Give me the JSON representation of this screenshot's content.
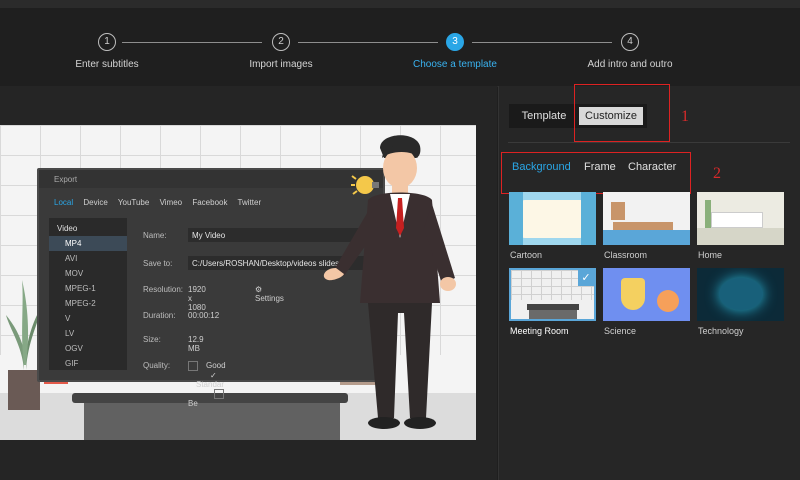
{
  "steps": [
    {
      "num": "1",
      "label": "Enter subtitles"
    },
    {
      "num": "2",
      "label": "Import images"
    },
    {
      "num": "3",
      "label": "Choose a template"
    },
    {
      "num": "4",
      "label": "Add intro and outro"
    }
  ],
  "export": {
    "title": "Export",
    "tabs": [
      "Local",
      "Device",
      "YouTube",
      "Vimeo",
      "Facebook",
      "Twitter"
    ],
    "category": "Video",
    "formats": [
      "MP4",
      "AVI",
      "MOV",
      "MPEG-1",
      "MPEG-2",
      "V",
      "LV",
      "OGV",
      "GIF"
    ],
    "name_label": "Name:",
    "name_value": "My Video",
    "save_label": "Save to:",
    "save_value": "C:/Users/ROSHAN/Desktop/videos slides",
    "res_label": "Resolution:",
    "res_value": "1920 x 1080",
    "settings": "Settings",
    "dur_label": "Duration:",
    "dur_value": "00:00:12",
    "size_label": "Size:",
    "size_value": "12.9 MB",
    "quality_label": "Quality:",
    "q_good": "Good",
    "q_standard": "Standar",
    "q_best": "Be"
  },
  "panel": {
    "toggle": {
      "template": "Template",
      "customize": "Customize"
    },
    "annotation1": "1",
    "annotation2": "2",
    "subtabs": [
      "Background",
      "Frame",
      "Character"
    ],
    "thumbnails": [
      {
        "label": "Cartoon"
      },
      {
        "label": "Classroom"
      },
      {
        "label": "Home"
      },
      {
        "label": "Meeting Room",
        "selected": true
      },
      {
        "label": "Science"
      },
      {
        "label": "Technology"
      }
    ]
  },
  "colors": {
    "accent": "#2aa6e6",
    "annotation": "#d82a2a"
  }
}
